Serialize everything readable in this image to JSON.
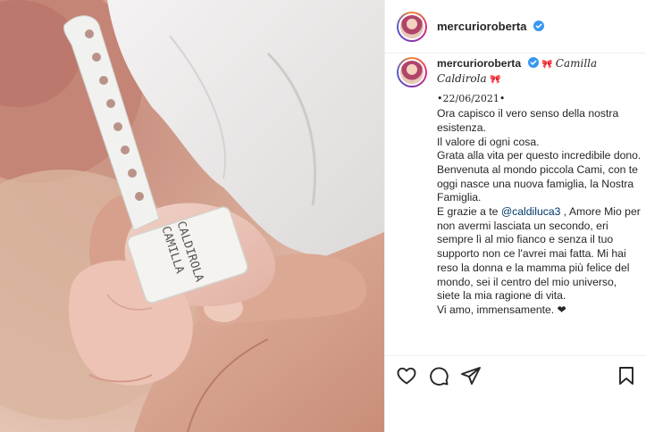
{
  "post": {
    "username": "mercurioroberta",
    "caption": {
      "title_name": "Camilla Caldirola",
      "bow": "🎀",
      "date": "•22/06/2021•",
      "lines": [
        "Ora capisco il vero senso della nostra esistenza.",
        "Il valore di ogni cosa.",
        "Grata alla vita per questo incredibile dono.",
        "Benvenuta al mondo piccola Cami, con te oggi nasce una nuova famiglia, la Nostra Famiglia."
      ],
      "thanks_prefix": "E grazie a te ",
      "mention": "@caldiluca3",
      "thanks_rest": " , Amore Mio per non avermi lasciata un secondo, eri sempre lì al mio fianco e senza il tuo supporto non ce l'avrei mai fatta. Mi hai reso la donna e la mamma più felice del mondo, sei il centro del mio universo, siete la mia ragione di vita.",
      "closing": "Vi amo, immensamente. ❤"
    },
    "photo": {
      "wristband_text_1": "CALDIROLA",
      "wristband_text_2": "CAMILLA"
    }
  },
  "icons": {
    "verified": "verified-badge-icon",
    "like": "heart-icon",
    "comment": "comment-icon",
    "share": "paper-plane-icon",
    "save": "bookmark-icon"
  },
  "colors": {
    "verified": "#3897f0",
    "mention": "#00376b",
    "text": "#262626"
  }
}
